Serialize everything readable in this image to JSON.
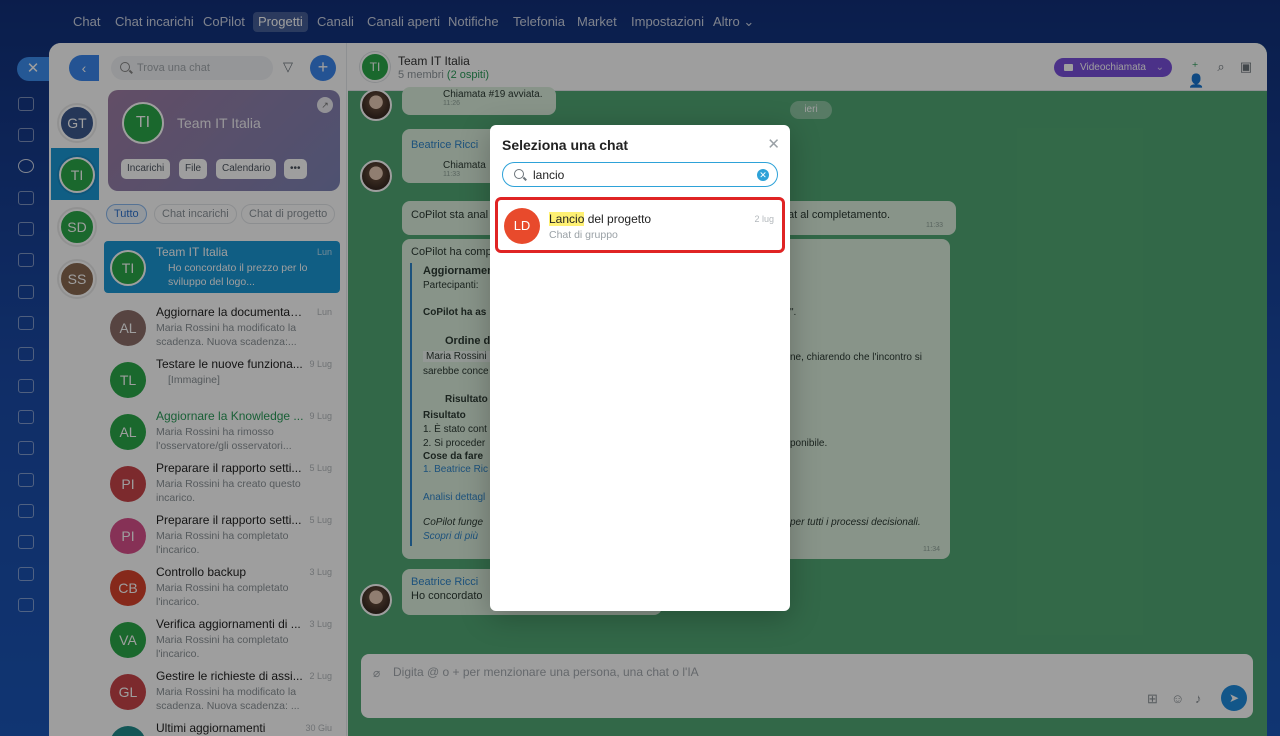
{
  "topnav": {
    "items": [
      "Chat",
      "Chat incarichi",
      "CoPilot",
      "Progetti",
      "Canali",
      "Canali aperti",
      "Notifiche",
      "Telefonia",
      "Market",
      "Impostazioni",
      "Altro ⌄"
    ],
    "active": "Progetti"
  },
  "groups": [
    "GT",
    "TI",
    "SD",
    "SS"
  ],
  "list": {
    "search_placeholder": "Trova una chat",
    "card": {
      "avatar": "TI",
      "title": "Team IT Italia",
      "chips": [
        "Incarichi",
        "File",
        "Calendario",
        "•••"
      ]
    },
    "tabs": [
      "Tutto",
      "Chat incarichi",
      "Chat di progetto"
    ],
    "rows": [
      {
        "avatar": "TI",
        "name": "Team IT Italia",
        "date": "Lun",
        "msg": "Ho concordato il prezzo per lo sviluppo del logo..."
      },
      {
        "avatar": "AL",
        "name": "Aggiornare la documentazi...",
        "date": "Lun",
        "msg": "Maria Rossini ha modificato la scadenza. Nuova scadenza:..."
      },
      {
        "avatar": "TL",
        "name": "Testare le nuove funziona...",
        "date": "9 Lug",
        "msg": "[Immagine]"
      },
      {
        "avatar": "AL",
        "name": "Aggiornare la Knowledge ...",
        "date": "9 Lug",
        "msg": "Maria Rossini ha rimosso l'osservatore/gli osservatori..."
      },
      {
        "avatar": "PI",
        "name": "Preparare il rapporto setti...",
        "date": "5 Lug",
        "msg": "Maria Rossini ha creato questo incarico."
      },
      {
        "avatar": "PI",
        "name": "Preparare il rapporto setti...",
        "date": "5 Lug",
        "msg": "Maria Rossini ha completato l'incarico."
      },
      {
        "avatar": "CB",
        "name": "Controllo backup",
        "date": "3 Lug",
        "msg": "Maria Rossini ha completato l'incarico."
      },
      {
        "avatar": "VA",
        "name": "Verifica aggiornamenti di ...",
        "date": "3 Lug",
        "msg": "Maria Rossini ha completato l'incarico."
      },
      {
        "avatar": "GL",
        "name": "Gestire le richieste di assi...",
        "date": "2 Lug",
        "msg": "Maria Rossini ha modificato la scadenza. Nuova scadenza: ..."
      },
      {
        "avatar": "",
        "name": "Ultimi aggiornamenti",
        "date": "30 Giu",
        "msg": ""
      }
    ]
  },
  "chat": {
    "avatar": "TI",
    "title": "Team IT Italia",
    "members": "5 membri",
    "guests": "(2 ospiti)",
    "video_label": "Videochiamata",
    "date_pill": "ieri",
    "msg_call_top": "Chiamata #19 avviata.",
    "msg_call_top_time": "11:26",
    "sender1": "Beatrice Ricci",
    "msg_call2": "Chiamata",
    "msg_call2_time": "11:33",
    "copilot_line": "CoPilot sta anal",
    "copilot_line_end": "at al completamento.",
    "copilot_line_time": "11:33",
    "copilot_summary_head": "CoPilot ha comp",
    "summary_lines": [
      "Aggiornamen",
      "Partecipanti:",
      "CoPilot ha as",
      "Ordine d",
      "Maria Rossini",
      "sarebbe conce",
      "Risultato",
      "Risultato",
      "1. È stato cont",
      "2. Si proceder",
      "Cose da fare",
      "1. Beatrice Ric",
      "Analisi dettagl",
      "CoPilot funge",
      "Scopri di più"
    ],
    "summary_right": [
      "\".",
      "ne, chiarendo che l'incontro si",
      "ponibile.",
      "per tutti i processi decisionali."
    ],
    "summary_time": "11:34",
    "sender2": "Beatrice Ricci",
    "msg_last": "Ho concordato",
    "composer_placeholder": "Digita @ o + per menzionare una persona, una chat o l'IA"
  },
  "modal": {
    "title": "Seleziona una chat",
    "search_value": "lancio",
    "result": {
      "avatar": "LD",
      "highlight": "Lancio",
      "name_rest": " del progetto",
      "subtitle": "Chat di gruppo",
      "date": "2 lug"
    }
  },
  "colors": {
    "accent": "#1b98d6",
    "video": "#7a4fdc",
    "result_border": "#e02424",
    "chat_bg": "#52a974"
  }
}
